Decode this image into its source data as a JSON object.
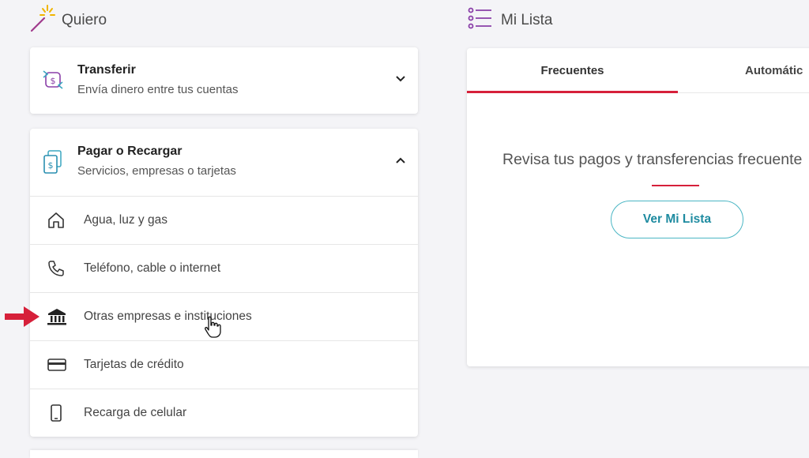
{
  "quiero": {
    "title": "Quiero"
  },
  "transferir": {
    "title": "Transferir",
    "subtitle": "Envía dinero entre tus cuentas"
  },
  "pagar": {
    "title": "Pagar o Recargar",
    "subtitle": "Servicios, empresas o tarjetas",
    "items": [
      {
        "label": "Agua, luz y gas",
        "icon": "house-icon"
      },
      {
        "label": "Teléfono, cable o internet",
        "icon": "phone-icon"
      },
      {
        "label": "Otras empresas e instituciones",
        "icon": "bank-icon"
      },
      {
        "label": "Tarjetas de crédito",
        "icon": "credit-card-icon"
      },
      {
        "label": "Recarga de celular",
        "icon": "mobile-phone-icon"
      }
    ]
  },
  "lista": {
    "title": "Mi Lista",
    "tabs": [
      "Frecuentes",
      "Automátic"
    ],
    "message": "Revisa tus pagos y transferencias frecuente",
    "button": "Ver Mi Lista"
  },
  "colors": {
    "accent_red": "#d6203a",
    "teal": "#1e8ba0",
    "purple": "#8a3fa8"
  }
}
